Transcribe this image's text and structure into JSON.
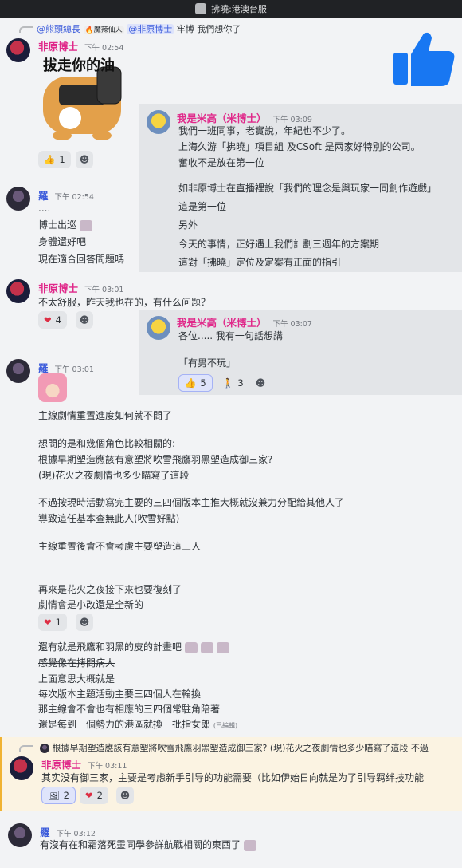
{
  "window": {
    "title": "拂曉:港澳台服"
  },
  "msg1": {
    "reply_ref": "@熊頭總長",
    "reply_badge": "🔥魔辣仙人",
    "reply_mention": "@非原博士",
    "reply_text": "牢博 我們想你了",
    "author": "非原博士",
    "time": "下午 02:54",
    "sticker_text": "拔走你的油",
    "reactions": [
      {
        "emoji": "👍",
        "count": "1"
      }
    ]
  },
  "quote1": {
    "author": "我是米高（米博士）",
    "time": "下午 03:09",
    "lines": [
      "我們一班同事，老實說，年紀也不少了。",
      "上海久游「拂曉」項目組 及CSoft 是兩家好特別的公司。",
      "奮收不是放在第一位",
      "",
      "如非原博士在直播裡說「我們的理念是與玩家一同創作遊戲」",
      "這是第一位",
      "另外",
      "今天的事情，正好遇上我們計劃三週年的方案期",
      "這對「拂曉」定位及定案有正面的指引"
    ]
  },
  "msg2": {
    "author": "羅",
    "time": "下午 02:54",
    "lines": [
      "....",
      "博士出巡",
      "身體還好吧",
      "現在適合回答問題嗎"
    ]
  },
  "msg3": {
    "author": "非原博士",
    "time": "下午 03:01",
    "text": "不太舒服，昨天我也在的，有什么问题？",
    "reactions": [
      {
        "emoji": "❤",
        "count": "4"
      }
    ]
  },
  "quote2": {
    "author": "我是米高（米博士）",
    "time": "下午 03:07",
    "lines": [
      "各位..... 我有一句話想講",
      "",
      "「有男不玩」"
    ],
    "reactions": [
      {
        "emoji": "👍",
        "count": "5"
      },
      {
        "emoji": "🚶",
        "count": "3"
      }
    ]
  },
  "msg4": {
    "author": "羅",
    "time": "下午 03:01",
    "lines": [
      "主線劇情重置進度如何就不問了",
      "",
      "想問的是和幾個角色比較相關的:",
      "根據早期塑造應該有意塑將吹雪飛鷹羽黑塑造成御三家?",
      "(現)花火之夜劇情也多少瞄寫了這段",
      "",
      "不過按現時活動寫完主要的三四個版本主推大概就沒兼力分配給其他人了",
      "導致這任基本查無此人(吹雪好點)",
      "",
      "主線重置後會不會考慮主要塑造這三人",
      "",
      "",
      "再來是花火之夜接下來也要復刻了",
      "劇情會是小改還是全新的"
    ],
    "reactions": [
      {
        "emoji": "❤",
        "count": "1"
      }
    ],
    "lines2": [
      "還有就是飛鷹和羽黑的皮的計畫吧",
      "感覺像在拷問病人",
      "上面意思大概就是",
      "每次版本主題活動主要三四個人在輪換",
      "那主線會不會也有相應的三四個常駐角陪著",
      "還是每到一個勢力的港區就換一批指女郎"
    ],
    "edited": "(已編輯)"
  },
  "msg5": {
    "reply_text": "根據早期塑造應該有意塑將吹雪飛鷹羽黑塑造成御三家? (現)花火之夜劇情也多少瞄寫了這段 不過",
    "author": "非原博士",
    "time": "下午 03:11",
    "text": "其实没有御三家，主要是考虑新手引导的功能需要（比如伊始日向就是为了引导羁绊技功能",
    "reactions": [
      {
        "emoji": "🖼",
        "count": "2"
      },
      {
        "emoji": "❤",
        "count": "2"
      }
    ]
  },
  "msg6": {
    "author": "羅",
    "time": "下午 03:12",
    "text": "有沒有在和霜落死靈同學參詳航戰相關的東西了"
  },
  "colors": {
    "accent": "#3b5bdb",
    "pink_name": "#e0298a",
    "thumb_big": "#1877f2"
  }
}
